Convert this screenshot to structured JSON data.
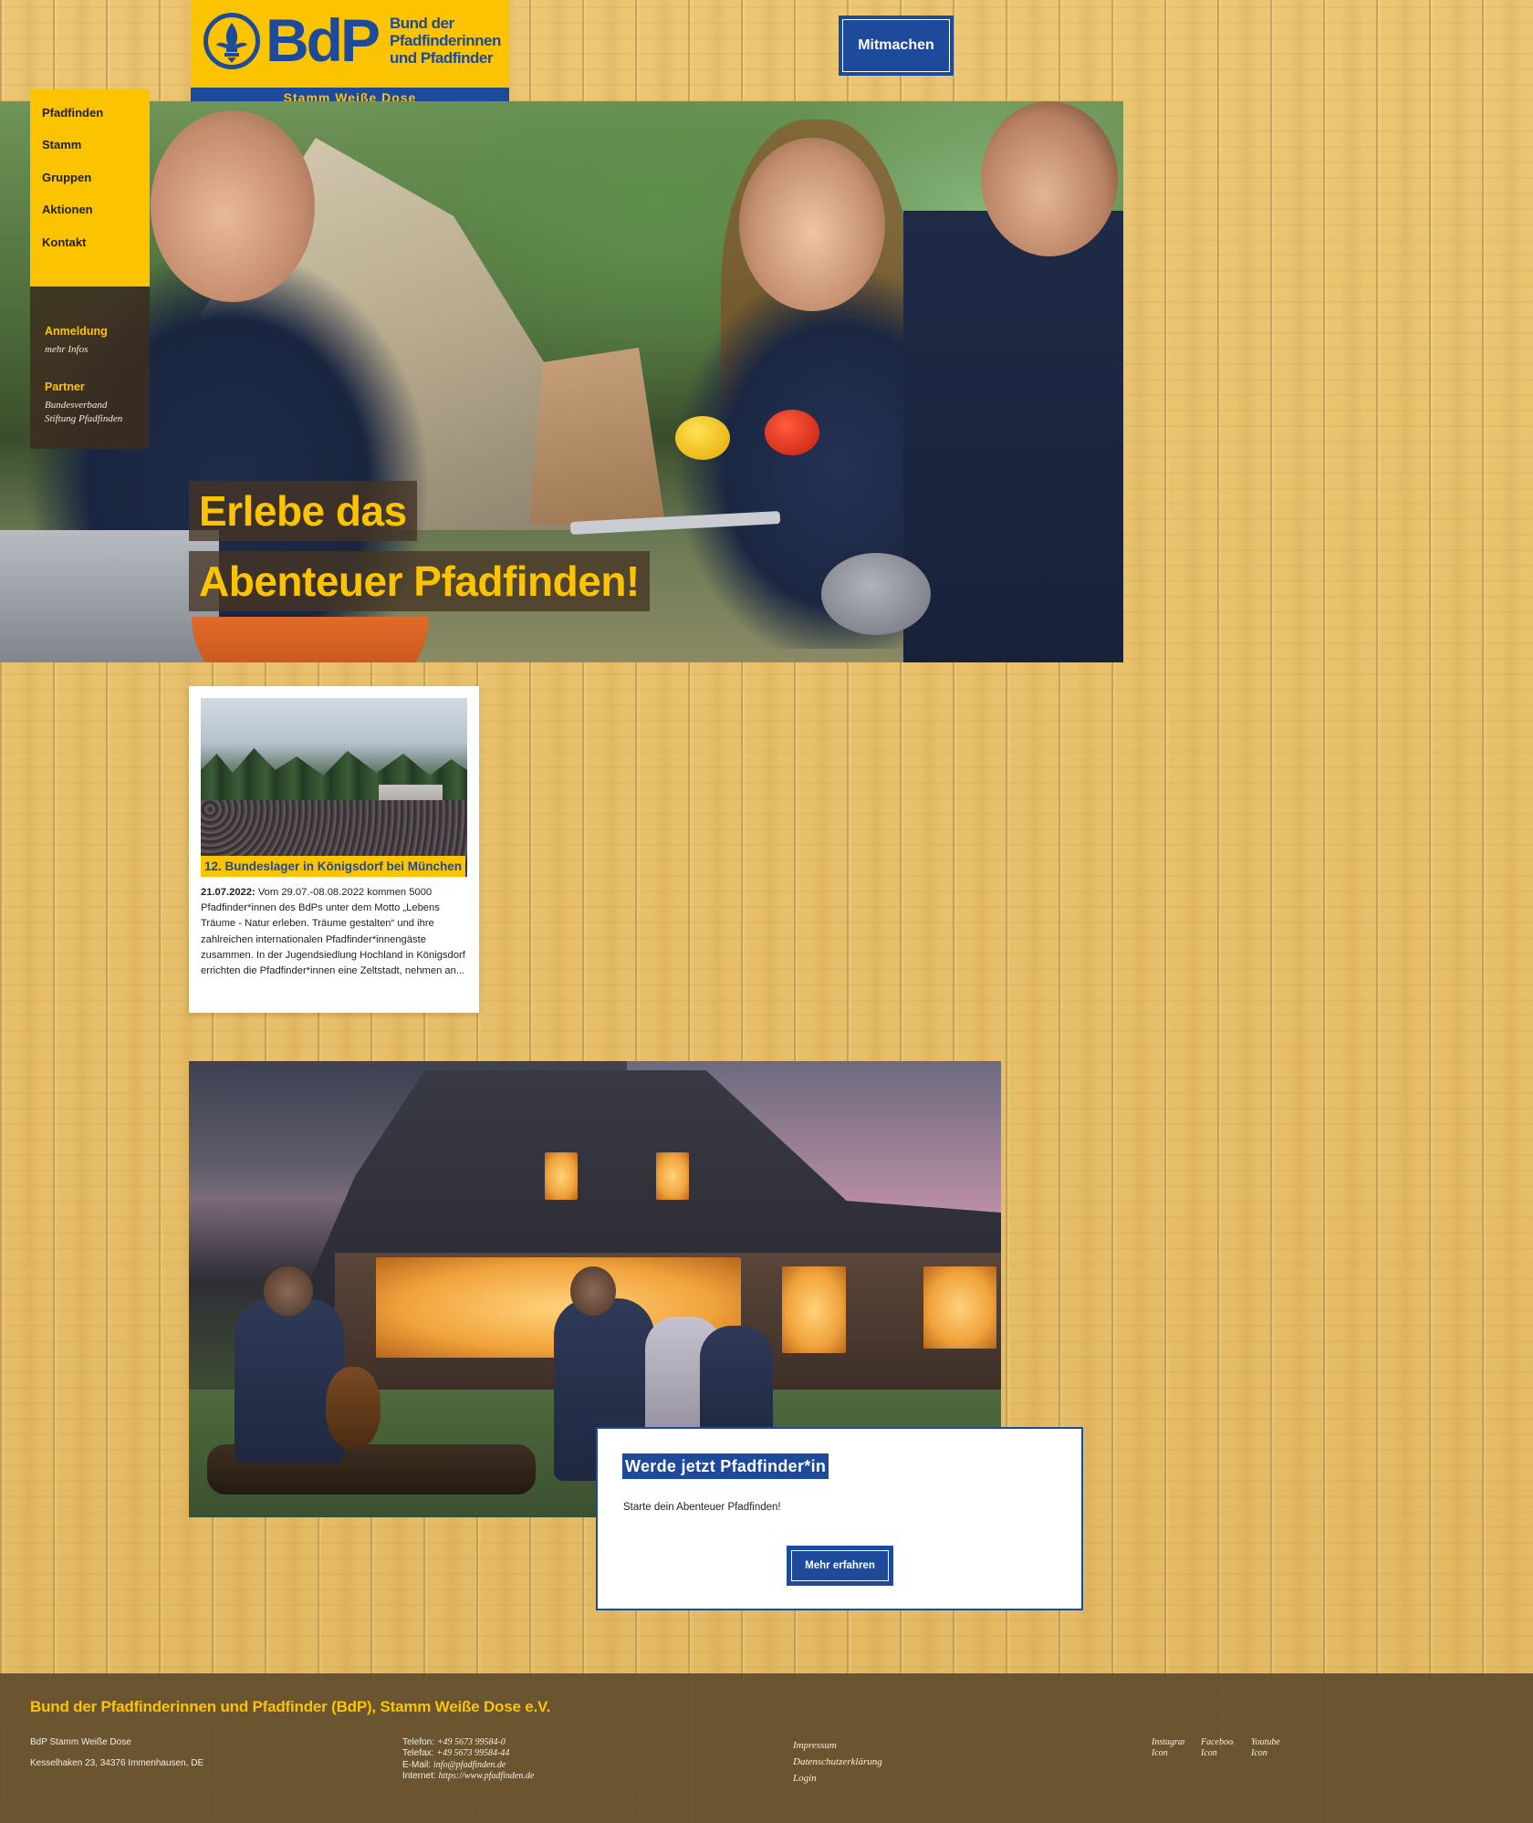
{
  "logo": {
    "wordmark": "BdP",
    "name_line1": "Bund der",
    "name_line2": "Pfadfinderinnen",
    "name_line3": "und Pfadfinder",
    "stamm": "Stamm Weiße Dose"
  },
  "header": {
    "cta_label": "Mitmachen"
  },
  "nav": {
    "items": [
      {
        "label": "Pfadfinden"
      },
      {
        "label": "Stamm"
      },
      {
        "label": "Gruppen"
      },
      {
        "label": "Aktionen"
      },
      {
        "label": "Kontakt"
      }
    ]
  },
  "sidebox": {
    "anmeldung_heading": "Anmeldung",
    "anmeldung_link": "mehr Infos",
    "partner_heading": "Partner",
    "partner_link1": "Bundesverband",
    "partner_link2": "Stiftung Pfadfinden"
  },
  "hero": {
    "line1": "Erlebe das",
    "line2": "Abenteuer Pfadfinden!"
  },
  "news": {
    "title": "12. Bundeslager in Königsdorf bei München",
    "date": "21.07.2022:",
    "text": " Vom 29.07.-08.08.2022 kommen 5000 Pfadfinder*innen des BdPs unter dem Motto „Lebens Träume - Natur erleben. Träume gestalten“ und ihre zahlreichen internationalen Pfadfinder*innengäste zusammen. In der Jugendsiedlung Hochland in Königsdorf errichten die Pfadfinder*innen eine Zeltstadt, nehmen an..."
  },
  "cta": {
    "title": "Werde jetzt Pfadfinder*in",
    "text": "Starte dein Abenteuer Pfadfinden!",
    "button": "Mehr erfahren"
  },
  "footer": {
    "title": "Bund der Pfadfinderinnen und Pfadfinder (BdP), Stamm Weiße Dose e.V.",
    "org": "BdP Stamm Weiße Dose",
    "address": "Kesselhaken 23, 34376 Immenhausen, DE",
    "phone_label": "Telefon: ",
    "phone": "+49 5673 99584-0",
    "fax_label": "Telefax: ",
    "fax": "+49 5673 99584-44",
    "email_label": "E-Mail: ",
    "email": "info@pfadfinden.de",
    "web_label": "Internet: ",
    "web": "https://www.pfadfinden.de",
    "links": [
      "Impressum",
      "Datenschutzerklärung",
      "Login"
    ],
    "social": [
      {
        "name": "Instagram",
        "suffix": "Icon"
      },
      {
        "name": "Facebook",
        "suffix": "Icon"
      },
      {
        "name": "Youtube",
        "suffix": "Icon"
      }
    ]
  },
  "colors": {
    "brand_yellow": "#fcc400",
    "brand_blue": "#1d4a9b",
    "footer_brown": "#624c2c"
  }
}
